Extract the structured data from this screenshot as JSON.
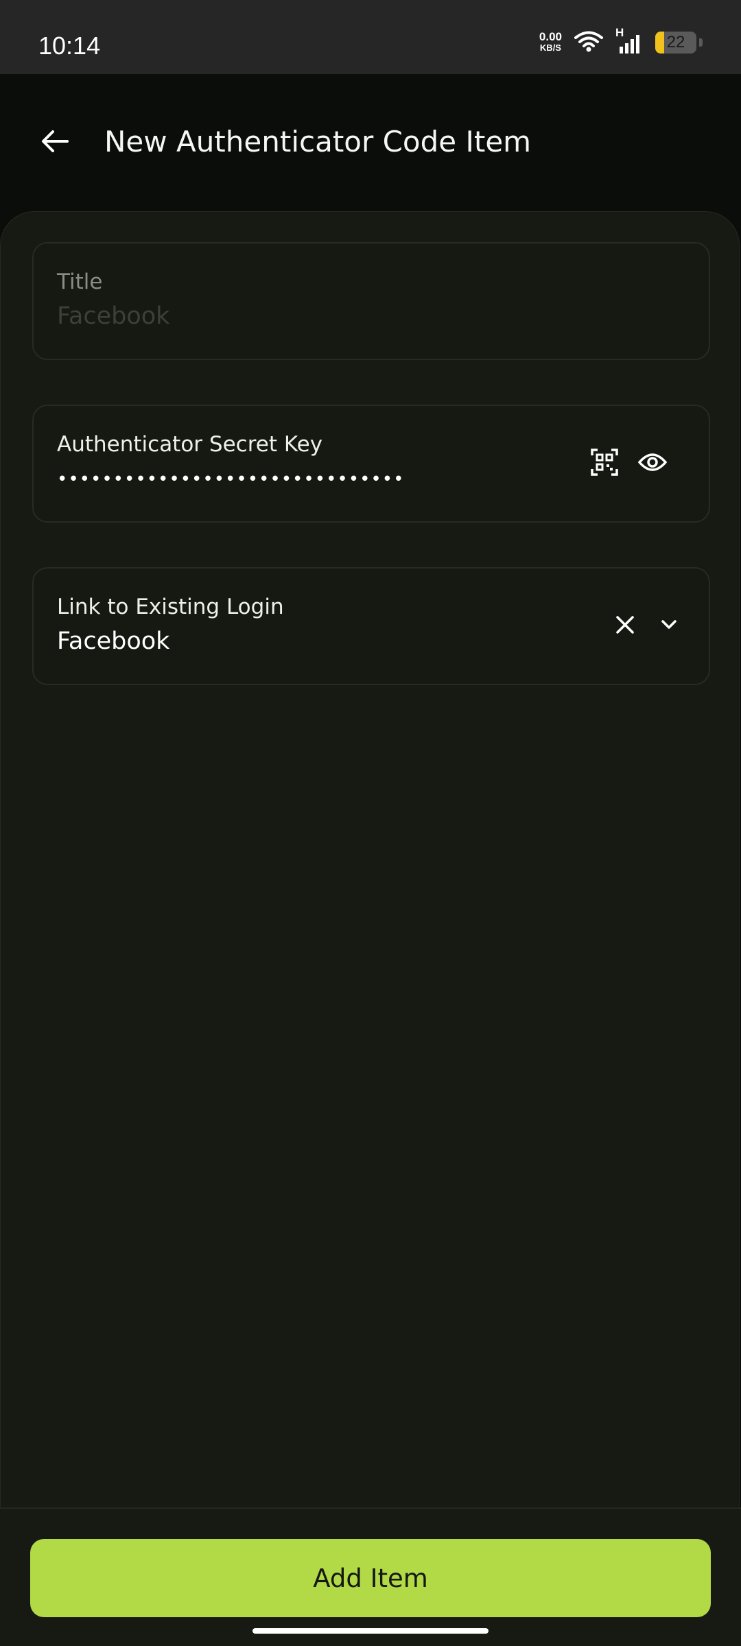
{
  "status_bar": {
    "time": "10:14",
    "net_speed_value": "0.00",
    "net_speed_unit": "KB/S",
    "network_type": "H",
    "battery_level": "22",
    "battery_fraction": 0.22
  },
  "app_bar": {
    "title": "New Authenticator Code Item",
    "back_icon": "arrow-left-icon"
  },
  "form": {
    "title_field": {
      "label": "Title",
      "placeholder": "Facebook",
      "value": ""
    },
    "secret_field": {
      "label": "Authenticator Secret Key",
      "masked_value": "•••••••••••••••••••••••••••••••",
      "scan_icon": "qr-scan-icon",
      "reveal_icon": "eye-icon"
    },
    "login_field": {
      "label": "Link to Existing Login",
      "value": "Facebook",
      "clear_icon": "close-icon",
      "expand_icon": "chevron-down-icon"
    }
  },
  "footer": {
    "add_button_label": "Add Item"
  },
  "colors": {
    "accent": "#b2d946",
    "background": "#0b0d0a",
    "surface": "#171913",
    "field_border": "#272b22"
  }
}
